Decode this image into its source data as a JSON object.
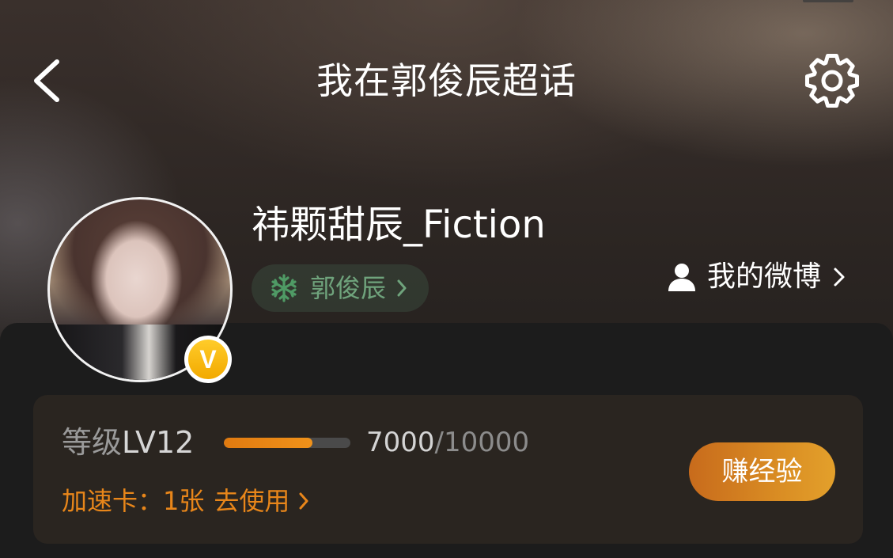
{
  "header": {
    "title": "我在郭俊辰超话",
    "back_icon": "chevron-left-icon",
    "settings_icon": "gear-icon"
  },
  "profile": {
    "username": "祎颗甜辰_Fiction",
    "verified_badge": "V",
    "topic_chip": {
      "icon": "snowflake-icon",
      "label": "郭俊辰",
      "color": "#6fa37c"
    },
    "my_weibo": {
      "icon": "user-icon",
      "label": "我的微博"
    }
  },
  "level_card": {
    "level_prefix": "等级",
    "level_value": "LV12",
    "exp_current": "7000",
    "exp_separator": "/",
    "exp_total": "10000",
    "progress_fraction": 0.7,
    "boost_label": "加速卡：",
    "boost_count": "1张",
    "boost_action": "去使用",
    "earn_button": "赚经验",
    "accent_color": "#e8861a"
  }
}
